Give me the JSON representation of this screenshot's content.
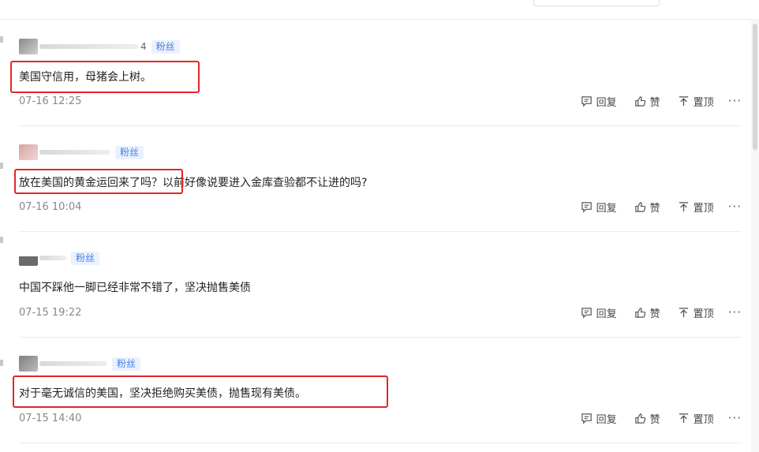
{
  "badge_label": "粉丝",
  "actions": {
    "reply": "回复",
    "like": "赞",
    "pin": "置顶",
    "more": "···"
  },
  "comments": [
    {
      "name_suffix": "4",
      "content": "美国守信用，母猪会上树。",
      "time": "07-16 12:25"
    },
    {
      "name_suffix": "",
      "content": "放在美国的黄金运回来了吗？以前好像说要进入金库查验都不让进的吗?",
      "time": "07-16 10:04"
    },
    {
      "name_suffix": "",
      "content": "中国不踩他一脚已经非常不错了，坚决抛售美债",
      "time": "07-15 19:22"
    },
    {
      "name_suffix": "",
      "content": "对于毫无诚信的美国，坚决拒绝购买美债，抛售现有美债。",
      "time": "07-15 14:40"
    }
  ],
  "colors": {
    "highlight": "#e0262b",
    "badge_text": "#4a7fe0",
    "badge_bg": "#eaf2ff"
  }
}
